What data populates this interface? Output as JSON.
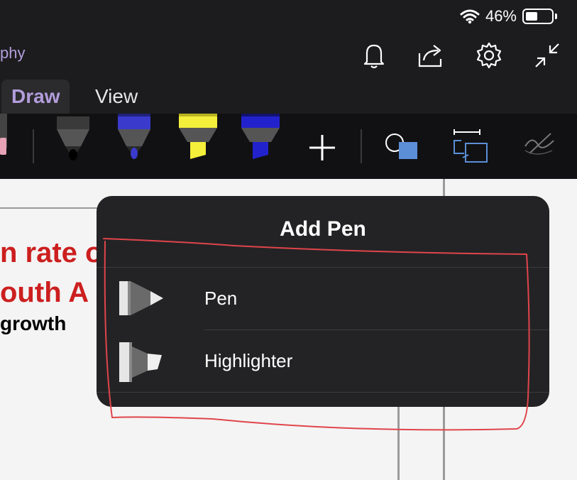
{
  "status_bar": {
    "battery_percent": "46%",
    "battery_level": 0.46
  },
  "header": {
    "doc_title": "phy"
  },
  "tabs": [
    {
      "label": "Draw",
      "active": true
    },
    {
      "label": "View",
      "active": false
    }
  ],
  "toolbar": {
    "pens": [
      {
        "name": "pink-marker",
        "color": "#e7a3b5"
      },
      {
        "name": "black-pen",
        "color": "#1a1a1a"
      },
      {
        "name": "blue-pen",
        "color": "#3a3acc"
      },
      {
        "name": "yellow-highlighter",
        "color": "#f4ef3a"
      },
      {
        "name": "blue-highlighter",
        "color": "#2222cc"
      }
    ],
    "icons": [
      "add-pen-icon",
      "shapes-icon",
      "lasso-select-icon",
      "handwriting-icon"
    ]
  },
  "document": {
    "line1": "n rate o",
    "line2": "outh A",
    "line3": "growth",
    "heading_color": "#cc1f1f"
  },
  "popover": {
    "title": "Add Pen",
    "items": [
      {
        "label": "Pen"
      },
      {
        "label": "Highlighter"
      }
    ]
  },
  "colors": {
    "accent": "#b39ddb",
    "annotation": "#e0454b"
  }
}
